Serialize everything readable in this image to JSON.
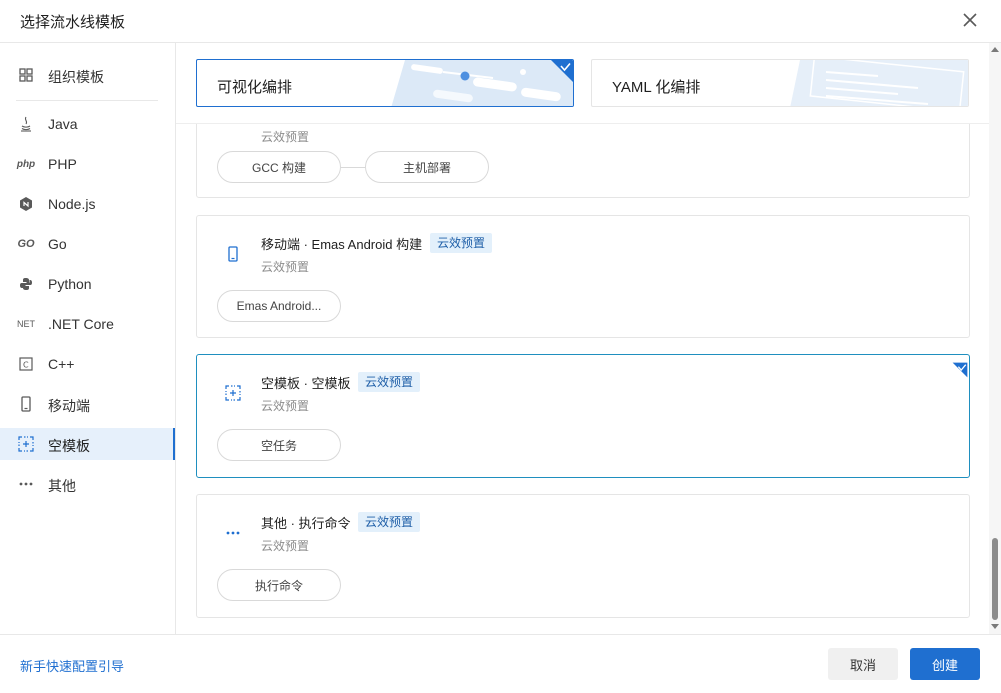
{
  "dialog": {
    "title": "选择流水线模板"
  },
  "sidebar": {
    "items": [
      {
        "label": "组织模板",
        "icon": "grid-icon"
      },
      {
        "label": "Java",
        "icon": "java-icon"
      },
      {
        "label": "PHP",
        "icon": "php-icon"
      },
      {
        "label": "Node.js",
        "icon": "nodejs-icon"
      },
      {
        "label": "Go",
        "icon": "go-icon"
      },
      {
        "label": "Python",
        "icon": "python-icon"
      },
      {
        "label": ".NET Core",
        "icon": "dotnet-icon"
      },
      {
        "label": "C++",
        "icon": "cpp-icon"
      },
      {
        "label": "移动端",
        "icon": "mobile-icon"
      },
      {
        "label": "空模板",
        "icon": "empty-template-icon",
        "active": true
      },
      {
        "label": "其他",
        "icon": "more-icon"
      }
    ],
    "dotnet_glyph": "NET",
    "php_glyph": "php",
    "go_glyph": "GO",
    "cpp_glyph": "C"
  },
  "modes": [
    {
      "label": "可视化编排",
      "selected": true
    },
    {
      "label": "YAML 化编排",
      "selected": false
    }
  ],
  "cards": [
    {
      "name": "",
      "tag": "",
      "subtitle": "云效预置",
      "jobs": [
        "GCC 构建",
        "主机部署"
      ],
      "selected": false
    },
    {
      "name": "移动端 · Emas Android 构建",
      "tag": "云效预置",
      "subtitle": "云效预置",
      "jobs": [
        "Emas Android..."
      ],
      "selected": false
    },
    {
      "name": "空模板 · 空模板",
      "tag": "云效预置",
      "subtitle": "云效预置",
      "jobs": [
        "空任务"
      ],
      "selected": true
    },
    {
      "name": "其他 · 执行命令",
      "tag": "云效预置",
      "subtitle": "云效预置",
      "jobs": [
        "执行命令"
      ],
      "selected": false
    }
  ],
  "footer": {
    "guide_link": "新手快速配置引导",
    "cancel_label": "取消",
    "create_label": "创建"
  },
  "colors": {
    "accent": "#1f6fd0",
    "tag_bg": "#e3f0fb",
    "active_bg": "#e6f0fb"
  }
}
